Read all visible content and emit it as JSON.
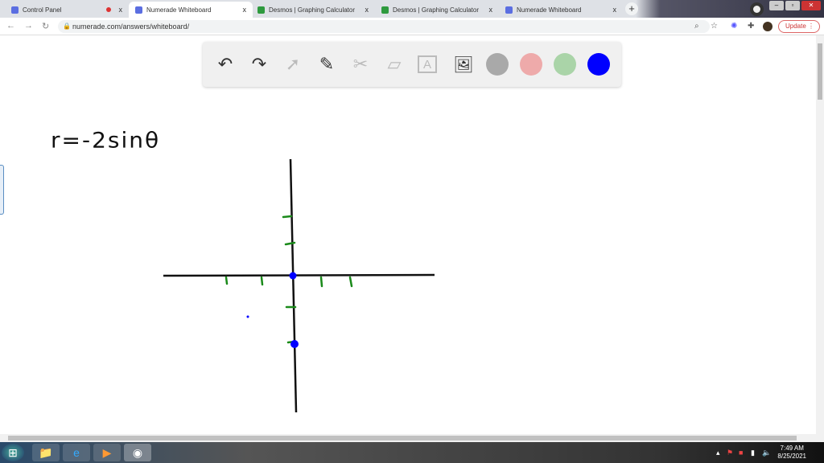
{
  "browser": {
    "tabs": [
      {
        "title": "Control Panel",
        "icon": "numerade-icon",
        "recording": true,
        "active": false
      },
      {
        "title": "Numerade Whiteboard",
        "icon": "numerade-icon",
        "active": true
      },
      {
        "title": "Desmos | Graphing Calculator",
        "icon": "desmos-icon",
        "active": false
      },
      {
        "title": "Desmos | Graphing Calculator",
        "icon": "desmos-icon",
        "active": false
      },
      {
        "title": "Numerade Whiteboard",
        "icon": "numerade-icon",
        "active": false
      }
    ],
    "close_glyph": "x",
    "new_tab": "+",
    "url": "numerade.com/answers/whiteboard/",
    "update_label": "Update"
  },
  "toolbar": {
    "tools": [
      "undo-icon",
      "redo-icon",
      "pointer-icon",
      "pen-icon",
      "tools-icon",
      "eraser-icon",
      "text-icon",
      "image-icon"
    ],
    "colors": [
      "#a9a9a9",
      "#eeaaaa",
      "#aad4a8",
      "#0000ff"
    ],
    "selected_color": "#0000ff"
  },
  "whiteboard": {
    "equation": "r=-2sinθ",
    "ink_colors": {
      "axes": "#111111",
      "ticks": "#1a8a1a",
      "points": "#0000ff"
    }
  },
  "taskbar": {
    "time": "7:49 AM",
    "date": "8/25/2021"
  }
}
